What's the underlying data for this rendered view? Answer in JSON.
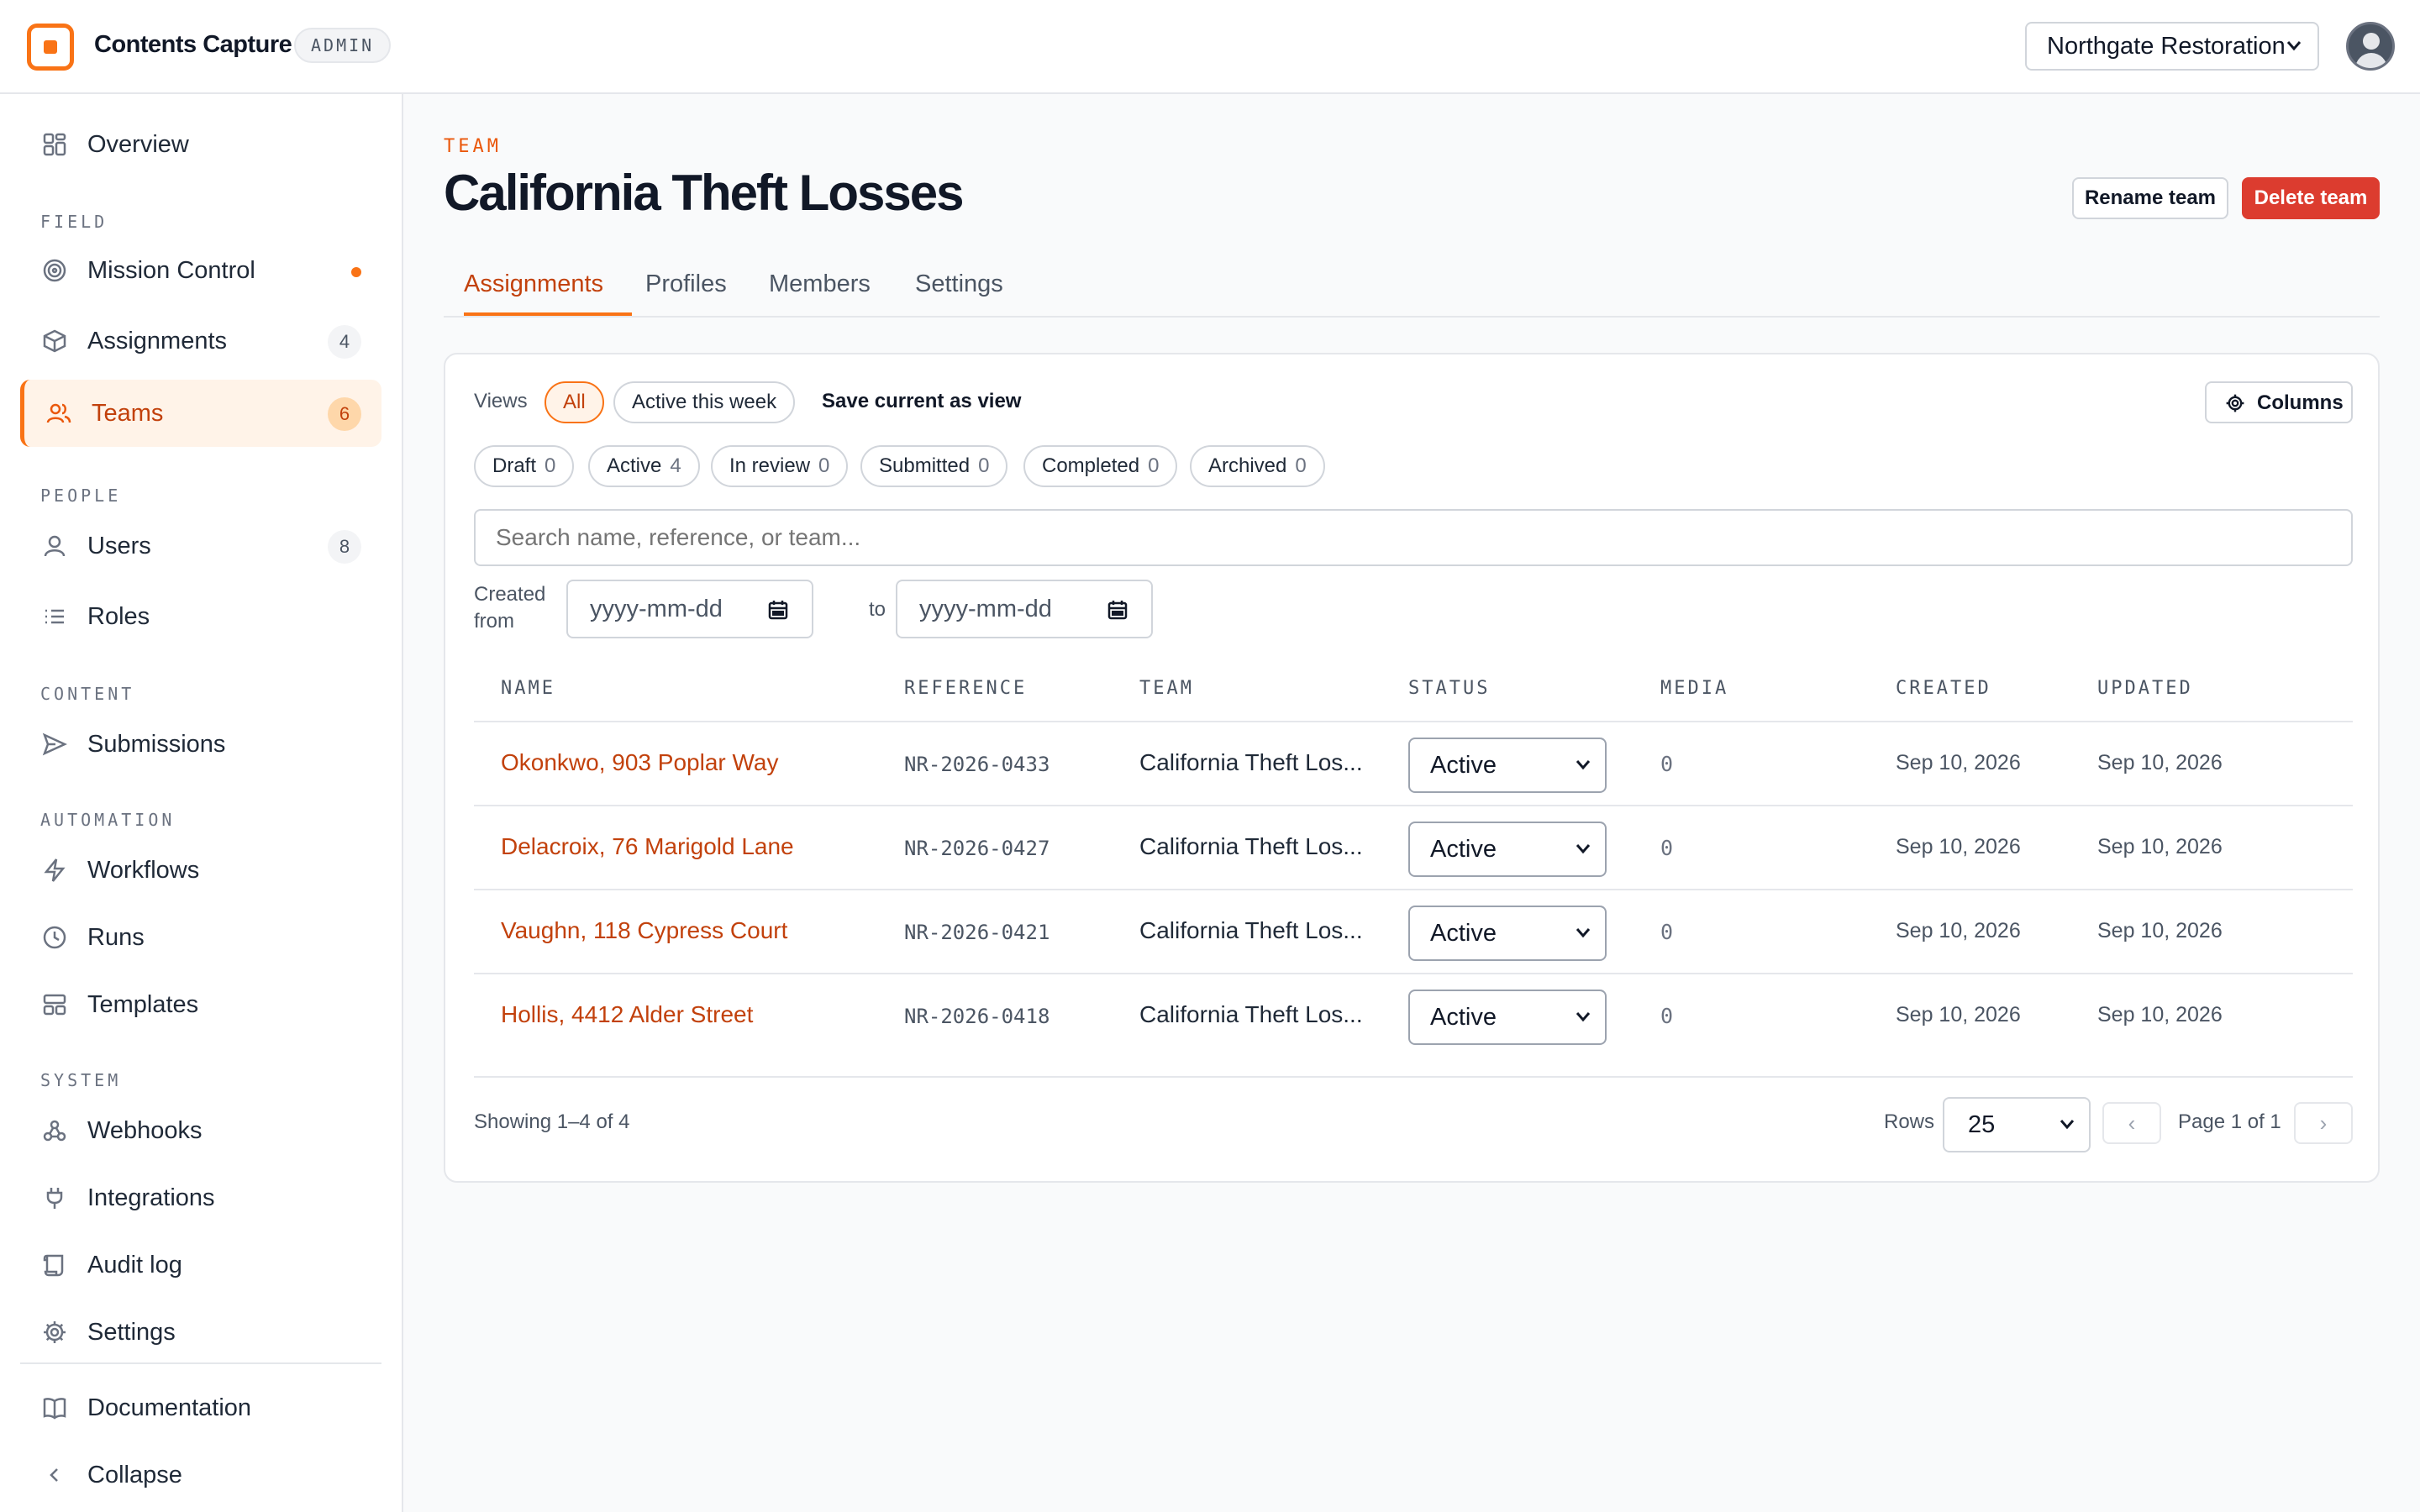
{
  "app": {
    "name": "Contents Capture",
    "badge": "ADMIN",
    "org": "Northgate Restoration"
  },
  "sidebar": {
    "overview": "Overview",
    "sections": {
      "field": "FIELD",
      "people": "PEOPLE",
      "content": "CONTENT",
      "automation": "AUTOMATION",
      "system": "SYSTEM"
    },
    "items": {
      "mission_control": "Mission Control",
      "assignments": "Assignments",
      "assignments_count": "4",
      "teams": "Teams",
      "teams_count": "6",
      "users": "Users",
      "users_count": "8",
      "roles": "Roles",
      "submissions": "Submissions",
      "workflows": "Workflows",
      "runs": "Runs",
      "templates": "Templates",
      "webhooks": "Webhooks",
      "integrations": "Integrations",
      "audit_log": "Audit log",
      "settings": "Settings",
      "documentation": "Documentation",
      "collapse": "Collapse"
    }
  },
  "page": {
    "eyebrow": "TEAM",
    "title": "California Theft Losses",
    "rename": "Rename team",
    "delete": "Delete team"
  },
  "tabs": [
    "Assignments",
    "Profiles",
    "Members",
    "Settings"
  ],
  "filters": {
    "views_label": "Views",
    "views": [
      "All",
      "Active this week"
    ],
    "save_view": "Save current as view",
    "columns": "Columns",
    "status_pills": [
      {
        "label": "Draft",
        "count": "0"
      },
      {
        "label": "Active",
        "count": "4"
      },
      {
        "label": "In review",
        "count": "0"
      },
      {
        "label": "Submitted",
        "count": "0"
      },
      {
        "label": "Completed",
        "count": "0"
      },
      {
        "label": "Archived",
        "count": "0"
      }
    ],
    "search_placeholder": "Search name, reference, or team...",
    "created_from": "Created from",
    "date_placeholder": "yyyy-mm-dd",
    "to": "to"
  },
  "table": {
    "headers": [
      "NAME",
      "REFERENCE",
      "TEAM",
      "STATUS",
      "MEDIA",
      "CREATED",
      "UPDATED"
    ],
    "rows": [
      {
        "name": "Okonkwo, 903 Poplar Way",
        "reference": "NR-2026-0433",
        "team": "California Theft Los...",
        "status": "Active",
        "media": "0",
        "created": "Sep 10, 2026",
        "updated": "Sep 10, 2026"
      },
      {
        "name": "Delacroix, 76 Marigold Lane",
        "reference": "NR-2026-0427",
        "team": "California Theft Los...",
        "status": "Active",
        "media": "0",
        "created": "Sep 10, 2026",
        "updated": "Sep 10, 2026"
      },
      {
        "name": "Vaughn, 118 Cypress Court",
        "reference": "NR-2026-0421",
        "team": "California Theft Los...",
        "status": "Active",
        "media": "0",
        "created": "Sep 10, 2026",
        "updated": "Sep 10, 2026"
      },
      {
        "name": "Hollis, 4412 Alder Street",
        "reference": "NR-2026-0418",
        "team": "California Theft Los...",
        "status": "Active",
        "media": "0",
        "created": "Sep 10, 2026",
        "updated": "Sep 10, 2026"
      }
    ]
  },
  "footer": {
    "showing": "Showing 1–4 of 4",
    "rows_label": "Rows",
    "rows_value": "25",
    "page_info": "Page 1 of 1"
  },
  "colors": {
    "accent": "#f97316",
    "accent_text": "#c2410c",
    "danger": "#dc3c2f"
  }
}
